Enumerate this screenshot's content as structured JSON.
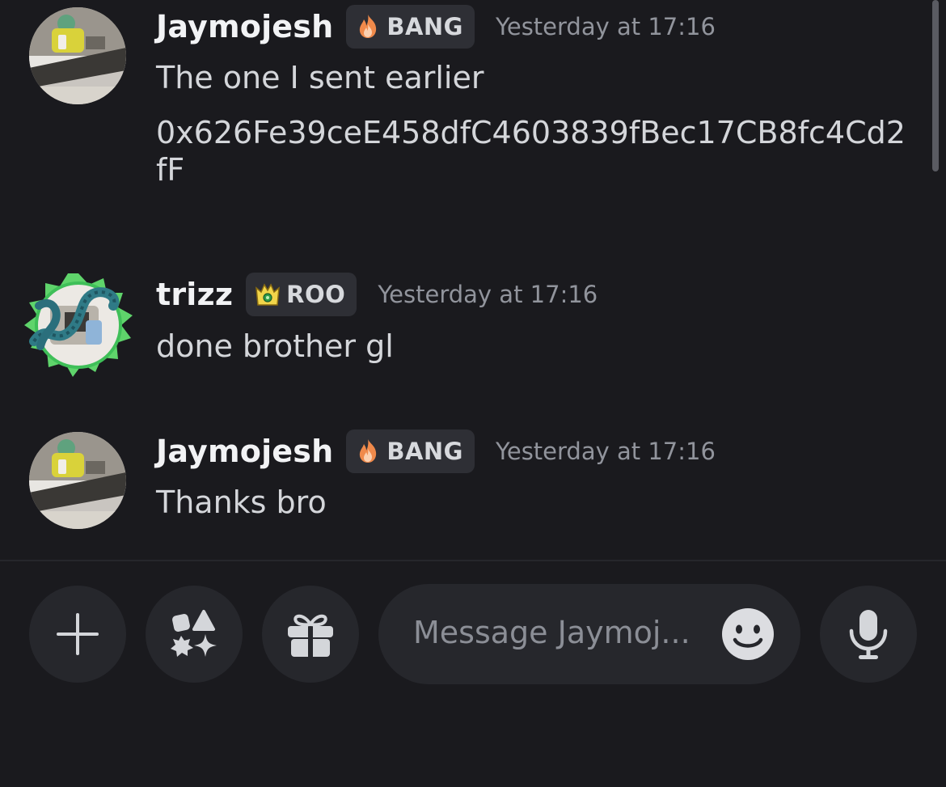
{
  "messages": [
    {
      "username": "Jaymojesh",
      "tag": "BANG",
      "tag_icon": "flame-icon",
      "timestamp": "Yesterday at 17:16",
      "lines": [
        "The one I sent earlier",
        "0x626Fe39ceE458dfC4603839fBec17CB8fc4Cd2fF"
      ]
    },
    {
      "username": "trizz",
      "tag": "ROO",
      "tag_icon": "crown-icon",
      "timestamp": "Yesterday at 17:16",
      "lines": [
        "done brother gl"
      ]
    },
    {
      "username": "Jaymojesh",
      "tag": "BANG",
      "tag_icon": "flame-icon",
      "timestamp": "Yesterday at 17:16",
      "lines": [
        "Thanks bro"
      ]
    }
  ],
  "composer": {
    "placeholder": "Message Jaymoj...",
    "buttons": [
      "plus-icon",
      "apps-icon",
      "gift-icon",
      "emoji-icon",
      "microphone-icon"
    ]
  },
  "colors": {
    "background": "#1a1a1e",
    "surface": "#26272c",
    "tag_background": "#2e2f35",
    "username": "#f2f3f5",
    "message_text": "#d4d6da",
    "timestamp": "#91949c",
    "placeholder": "#8b8e96"
  }
}
